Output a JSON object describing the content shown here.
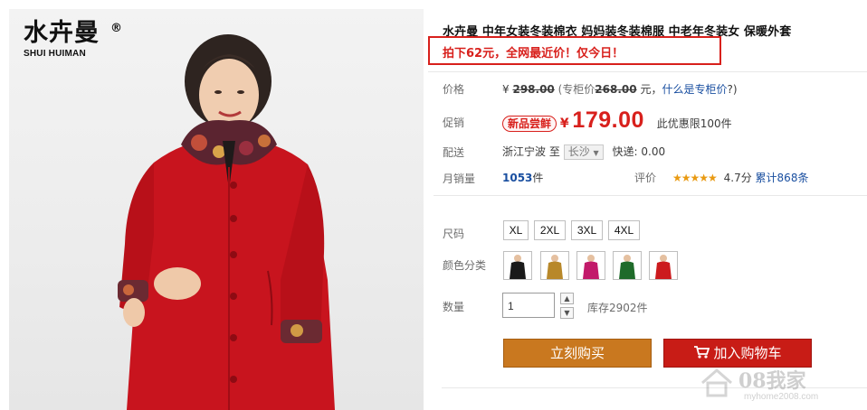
{
  "brand": {
    "name_cn": "水卉曼",
    "reg": "®",
    "name_en": "SHUI HUIMAN"
  },
  "product": {
    "title": "水卉曼 中年女装冬装棉衣 妈妈装冬装棉服 中老年冬装女 保暖外套",
    "promo": "拍下62元，全网最近价！仅今日！"
  },
  "price": {
    "label": "价格",
    "currency": "¥",
    "original": "298.00",
    "counter_prefix": "(专柜价",
    "counter_value": "268.00",
    "counter_suffix": "元，",
    "counter_link": "什么是专柜价",
    "counter_close": "?)"
  },
  "promotion": {
    "label": "促销",
    "badge": "新品尝鲜",
    "currency": "¥",
    "price": "179.00",
    "limit": "此优惠限100件"
  },
  "shipping": {
    "label": "配送",
    "from": "浙江宁波",
    "to_word": "至",
    "to_value": "长沙",
    "to_arrow": "▼",
    "fee": "快递: 0.00"
  },
  "sales": {
    "label": "月销量",
    "count": "1053",
    "unit": "件",
    "rating_label": "评价",
    "stars": "★★★★★",
    "score": "4.7分",
    "reviews": "累计868条"
  },
  "options": {
    "size_label": "尺码",
    "sizes": [
      "XL",
      "2XL",
      "3XL",
      "4XL"
    ],
    "color_label": "颜色分类",
    "colors": [
      "#1a1a1a",
      "#b8882a",
      "#c21a6a",
      "#1f6b2a",
      "#cc1b1e"
    ]
  },
  "quantity": {
    "label": "数量",
    "value": "1",
    "up": "▲",
    "down": "▼",
    "stock": "库存2902件"
  },
  "actions": {
    "buy_now": "立刻购买",
    "add_to_cart": "加入购物车",
    "cart_icon": "shopping-cart-icon"
  },
  "watermark": {
    "text": "08我家",
    "site": "myhome2008.com"
  },
  "colors": {
    "accent_red": "#d8201c",
    "buy_orange": "#c9781f",
    "cart_red": "#c81c16",
    "link_blue": "#1a4fa0"
  }
}
